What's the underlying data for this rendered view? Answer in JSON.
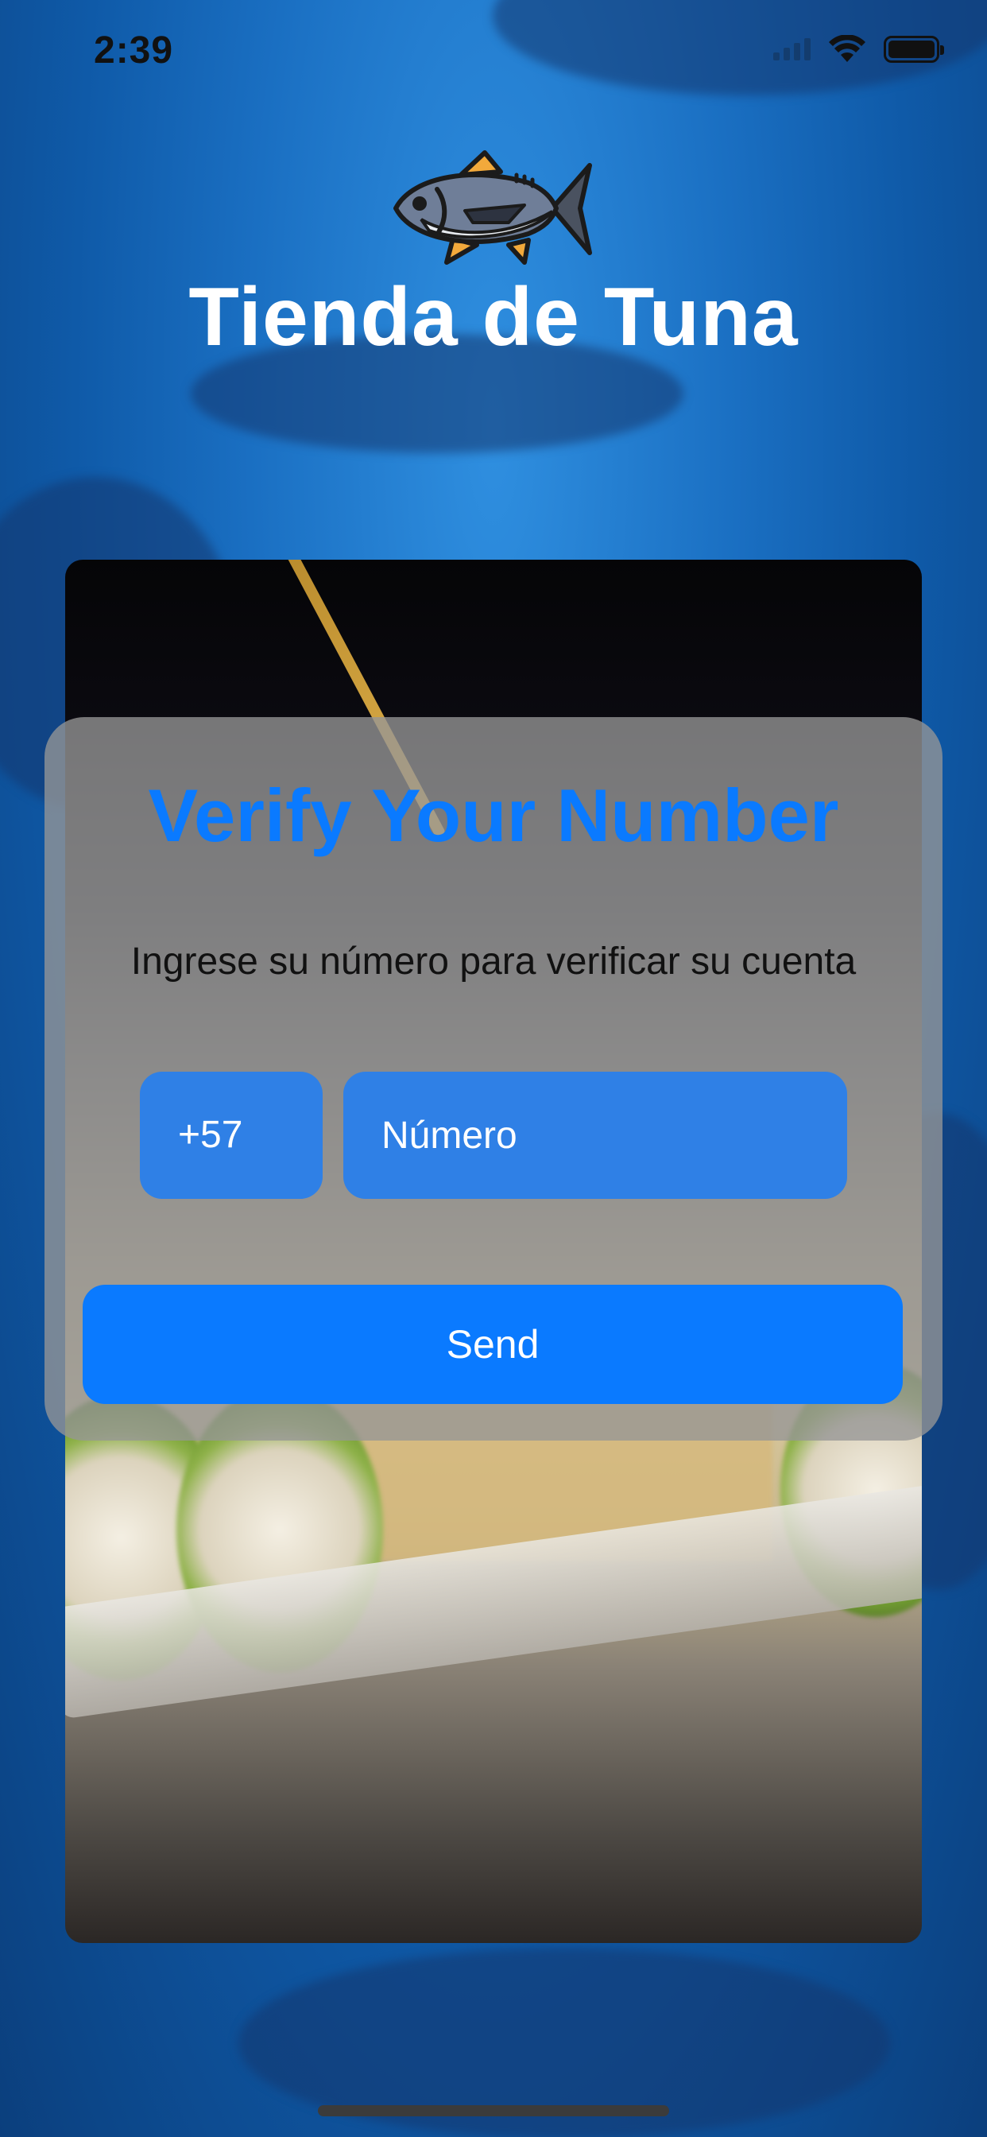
{
  "status_bar": {
    "time": "2:39"
  },
  "header": {
    "logo_icon": "tuna-fish-icon",
    "title": "Tienda de Tuna"
  },
  "verify": {
    "title": "Verify Your Number",
    "subtitle": "Ingrese su número para verificar su cuenta",
    "country_code": "+57",
    "phone_placeholder": "Número",
    "send_label": "Send"
  },
  "colors": {
    "accent": "#0A7AFF",
    "field_bg": "#2F80E6",
    "card_bg": "#969696"
  }
}
